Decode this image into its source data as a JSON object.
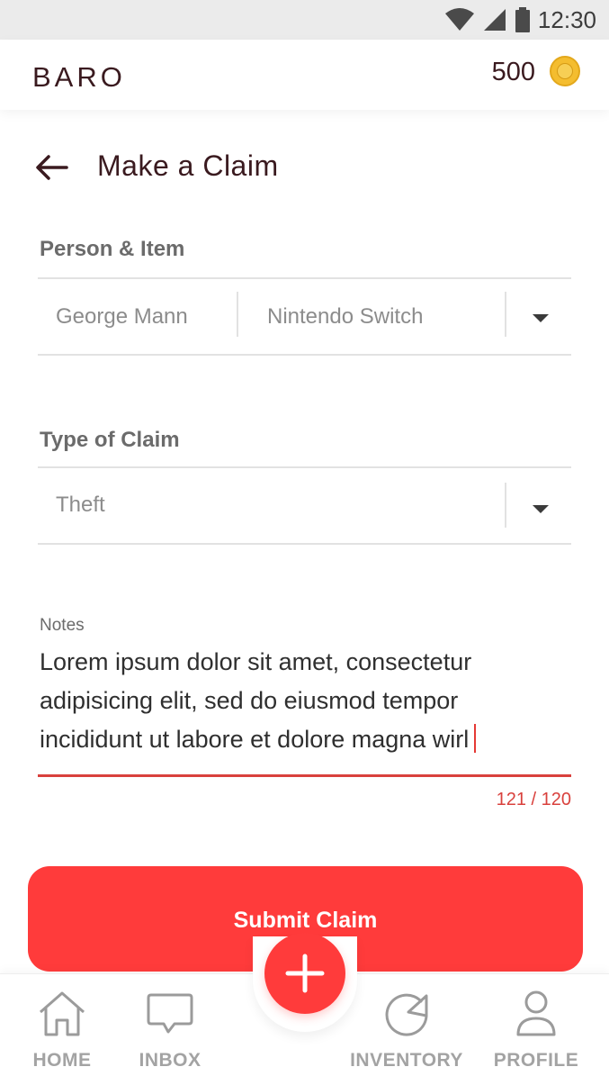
{
  "status_bar": {
    "time": "12:30"
  },
  "header": {
    "brand": "BARO",
    "coins": "500"
  },
  "page": {
    "title": "Make a Claim"
  },
  "person_item": {
    "label": "Person & Item",
    "person": "George Mann",
    "item": "Nintendo Switch"
  },
  "claim_type": {
    "label": "Type of Claim",
    "value": "Theft"
  },
  "notes": {
    "label": "Notes",
    "value": "Lorem ipsum dolor sit amet, consectetur adipisicing elit, sed do eiusmod tempor incididunt ut labore et dolore magna wirl",
    "char_count": "121 / 120"
  },
  "submit": {
    "label": "Submit Claim"
  },
  "nav": {
    "home": "HOME",
    "inbox": "INBOX",
    "inventory": "INVENTORY",
    "profile": "PROFILE"
  },
  "colors": {
    "accent": "#ff3b3b",
    "error": "#d9413d",
    "brand_text": "#3a1a1f",
    "coin": "#f4bd2f"
  },
  "icons": [
    "wifi-icon",
    "signal-icon",
    "battery-icon",
    "coin-icon",
    "back-arrow-icon",
    "chevron-down-icon",
    "home-icon",
    "inbox-icon",
    "plus-icon",
    "inventory-icon",
    "profile-icon"
  ]
}
